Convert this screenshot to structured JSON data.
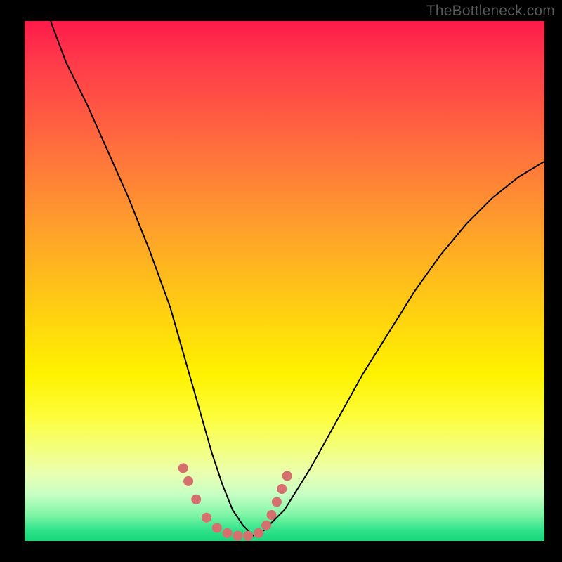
{
  "watermark": "TheBottleneck.com",
  "chart_data": {
    "type": "line",
    "title": "",
    "xlabel": "",
    "ylabel": "",
    "xlim": [
      0,
      100
    ],
    "ylim": [
      0,
      100
    ],
    "grid": false,
    "series": [
      {
        "name": "bottleneck-curve",
        "color": "#000000",
        "x": [
          5,
          8,
          12,
          16,
          20,
          24,
          28,
          30,
          32,
          34,
          36,
          38,
          40,
          42,
          44,
          46,
          50,
          55,
          60,
          65,
          70,
          75,
          80,
          85,
          90,
          95,
          100
        ],
        "values": [
          100,
          92,
          84,
          75,
          66,
          56,
          45,
          38,
          31,
          24,
          17,
          11,
          6,
          3,
          1,
          2,
          6,
          14,
          23,
          32,
          40,
          48,
          55,
          61,
          66,
          70,
          73
        ]
      }
    ],
    "markers": {
      "name": "highlight-points",
      "color": "#d6706f",
      "radius_px": 7,
      "points": [
        {
          "x": 30.5,
          "y": 14
        },
        {
          "x": 31.5,
          "y": 11.5
        },
        {
          "x": 33,
          "y": 8
        },
        {
          "x": 35,
          "y": 4.5
        },
        {
          "x": 37,
          "y": 2.5
        },
        {
          "x": 39,
          "y": 1.5
        },
        {
          "x": 41,
          "y": 1
        },
        {
          "x": 43,
          "y": 1
        },
        {
          "x": 45,
          "y": 1.5
        },
        {
          "x": 46.5,
          "y": 3
        },
        {
          "x": 47.5,
          "y": 5
        },
        {
          "x": 48.5,
          "y": 7.5
        },
        {
          "x": 49.5,
          "y": 10
        },
        {
          "x": 50.5,
          "y": 12.5
        }
      ]
    }
  }
}
